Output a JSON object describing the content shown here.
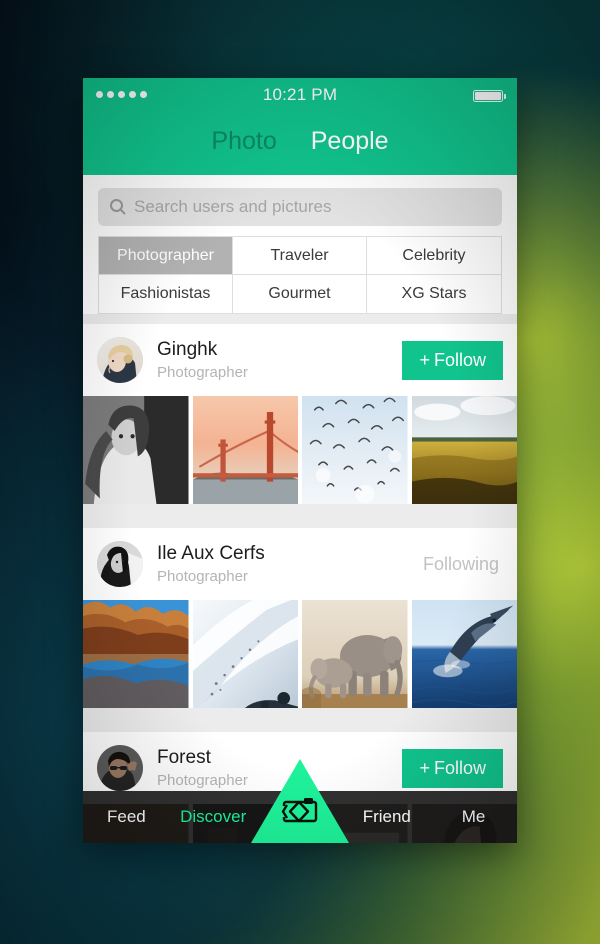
{
  "status_bar": {
    "signal_dots": 5,
    "time": "10:21 PM",
    "battery_icon": "battery-full-icon"
  },
  "top_tabs": {
    "photo_label": "Photo",
    "people_label": "People",
    "active": "People"
  },
  "search": {
    "placeholder": "Search users and pictures",
    "value": "",
    "icon": "search-icon"
  },
  "categories": {
    "selected": "Photographer",
    "items": [
      {
        "label": "Photographer",
        "selected": true
      },
      {
        "label": "Traveler",
        "selected": false
      },
      {
        "label": "Celebrity",
        "selected": false
      },
      {
        "label": "Fashionistas",
        "selected": false
      },
      {
        "label": "Gourmet",
        "selected": false
      },
      {
        "label": "XG Stars",
        "selected": false
      }
    ]
  },
  "feed": {
    "cards": [
      {
        "name": "Ginghk",
        "role": "Photographer",
        "action_label": "Follow",
        "action_plus": "+",
        "action_state": "follow",
        "avatar": "avatar-blonde-woman",
        "thumbs": [
          "photo-bw-portrait",
          "photo-golden-gate-sunset",
          "photo-birds-flying",
          "photo-golden-field"
        ]
      },
      {
        "name": "Ile Aux Cerfs",
        "role": "Photographer",
        "action_label": "Following",
        "action_plus": "",
        "action_state": "following",
        "avatar": "avatar-dark-hair-woman",
        "thumbs": [
          "photo-canyon-reflection",
          "photo-snow-slope",
          "photo-elephants",
          "photo-marlin-ocean"
        ]
      },
      {
        "name": "Forest",
        "role": "Photographer",
        "action_label": "Follow",
        "action_plus": "+",
        "action_state": "follow",
        "avatar": "avatar-man-glasses",
        "thumbs": [
          "photo-street-warm",
          "photo-indoor-dark",
          "photo-signage",
          "photo-portrait-woman"
        ]
      }
    ]
  },
  "bottom_nav": {
    "items": [
      {
        "label": "Feed",
        "active": false
      },
      {
        "label": "Discover",
        "active": true
      },
      {
        "label": "Friend",
        "active": false
      },
      {
        "label": "Me",
        "active": false
      }
    ],
    "camera_button": {
      "icon": "camera-icon",
      "shape": "triangle"
    }
  },
  "colors": {
    "brand_green": "#11c48d",
    "accent_green": "#1ef29a",
    "selected_gray": "#b2b2b2",
    "search_gray": "#e2e2e2",
    "nav_dark": "#141414"
  }
}
